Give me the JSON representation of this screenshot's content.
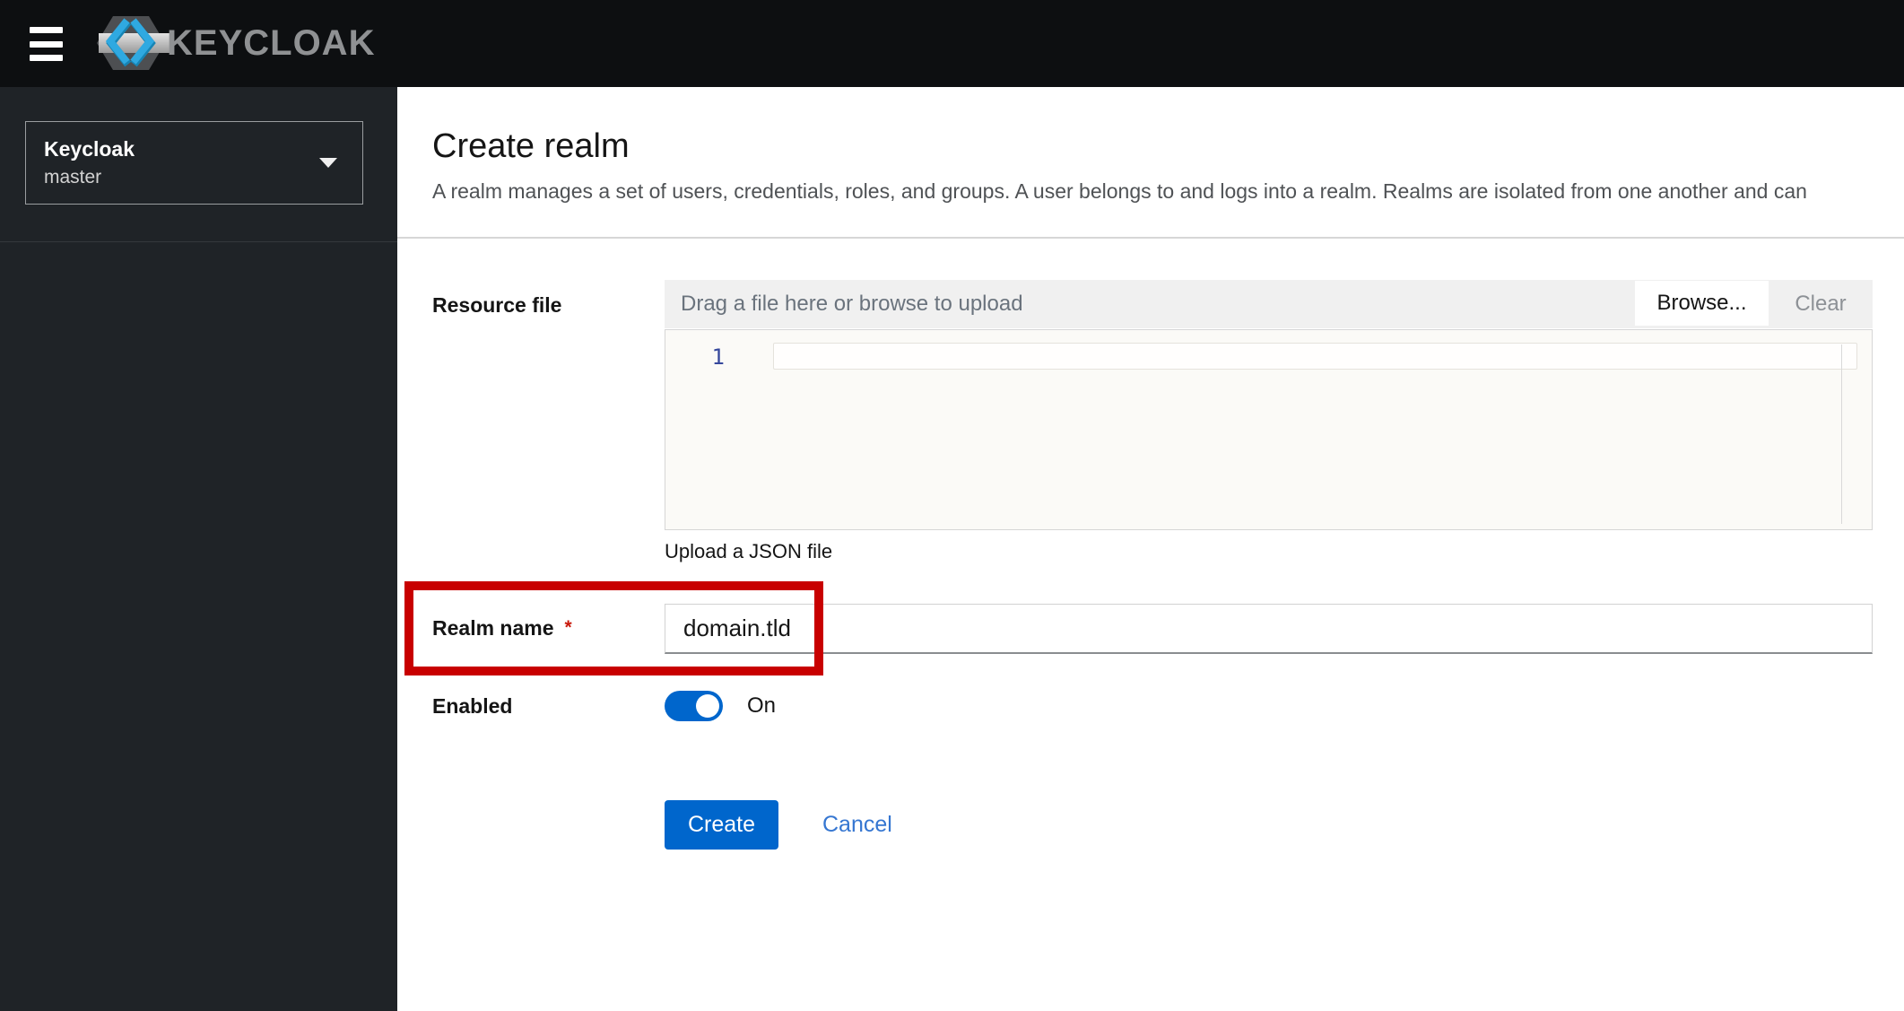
{
  "header": {
    "brand_text": "KEYCLOAK"
  },
  "sidebar": {
    "realm_switcher": {
      "realm_title": "Keycloak",
      "realm_name": "master"
    }
  },
  "page": {
    "title": "Create realm",
    "description": "A realm manages a set of users, credentials, roles, and groups. A user belongs to and logs into a realm. Realms are isolated from one another and can"
  },
  "form": {
    "resource_file": {
      "label": "Resource file",
      "placeholder": "Drag a file here or browse to upload",
      "browse_label": "Browse...",
      "clear_label": "Clear",
      "editor_line_number": "1",
      "helper_text": "Upload a JSON file"
    },
    "realm_name": {
      "label": "Realm name",
      "required_marker": "*",
      "value": "domain.tld"
    },
    "enabled": {
      "label": "Enabled",
      "state_label": "On"
    },
    "actions": {
      "create_label": "Create",
      "cancel_label": "Cancel"
    }
  },
  "colors": {
    "primary": "#0066cc",
    "annotation_red": "#c80000",
    "masthead_bg": "#0d0f11",
    "sidebar_bg": "#1f2327",
    "link_blue": "#3576d1"
  }
}
